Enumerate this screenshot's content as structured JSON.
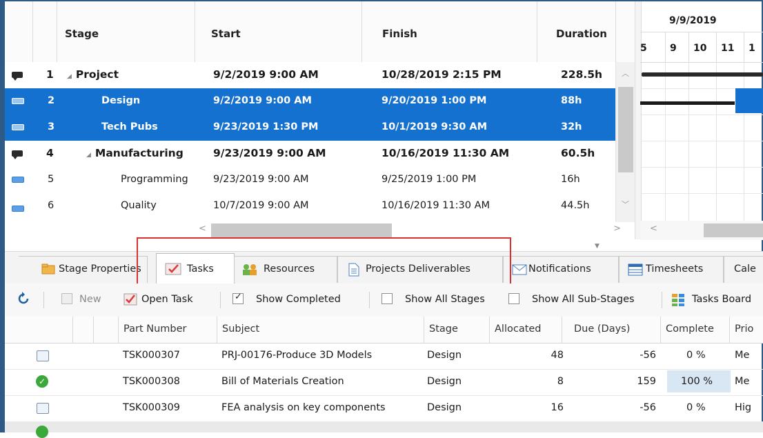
{
  "top_grid": {
    "headers": {
      "stage": "Stage",
      "start": "Start",
      "finish": "Finish",
      "duration": "Duration"
    },
    "rows": [
      {
        "num": "1",
        "stage": "Project",
        "start": "9/2/2019 9:00 AM",
        "finish": "10/28/2019 2:15 PM",
        "duration": "228.5h"
      },
      {
        "num": "2",
        "stage": "Design",
        "start": "9/2/2019 9:00 AM",
        "finish": "9/20/2019 1:00 PM",
        "duration": "88h"
      },
      {
        "num": "3",
        "stage": "Tech Pubs",
        "start": "9/23/2019 1:30 PM",
        "finish": "10/1/2019 9:30 AM",
        "duration": "32h"
      },
      {
        "num": "4",
        "stage": "Manufacturing",
        "start": "9/23/2019 9:00 AM",
        "finish": "10/16/2019 11:30 AM",
        "duration": "60.5h"
      },
      {
        "num": "5",
        "stage": "Programming",
        "start": "9/23/2019 9:00 AM",
        "finish": "9/25/2019 1:00 PM",
        "duration": "16h"
      },
      {
        "num": "6",
        "stage": "Quality",
        "start": "10/7/2019 9:00 AM",
        "finish": "10/16/2019 11:30 AM",
        "duration": "44.5h"
      }
    ]
  },
  "gantt": {
    "date": "9/9/2019",
    "days": [
      "5",
      "9",
      "10",
      "11",
      "1"
    ]
  },
  "tabs": [
    {
      "label": "Stage Properties",
      "icon": "stage-properties-icon"
    },
    {
      "label": "Tasks",
      "icon": "tasks-icon"
    },
    {
      "label": "Resources",
      "icon": "resources-icon"
    },
    {
      "label": "Projects Deliverables",
      "icon": "document-icon"
    },
    {
      "label": "Notifications",
      "icon": "envelope-icon"
    },
    {
      "label": "Timesheets",
      "icon": "timesheet-icon"
    },
    {
      "label": "Cale",
      "icon": ""
    }
  ],
  "toolbar": {
    "new": "New",
    "open_task": "Open Task",
    "show_completed": "Show Completed",
    "show_all_stages": "Show All Stages",
    "show_all_sub_stages": "Show All Sub-Stages",
    "tasks_board": "Tasks Board"
  },
  "task_table": {
    "headers": {
      "part_number": "Part Number",
      "subject": "Subject",
      "stage": "Stage",
      "allocated": "Allocated",
      "due_days": "Due (Days)",
      "complete": "Complete",
      "priority": "Prio"
    },
    "rows": [
      {
        "part_number": "TSK000307",
        "subject": "PRJ-00176-Produce 3D Models",
        "stage": "Design",
        "allocated": "48",
        "due_days": "-56",
        "complete": "0 %",
        "priority": "Me",
        "done": false
      },
      {
        "part_number": "TSK000308",
        "subject": "Bill of Materials Creation",
        "stage": "Design",
        "allocated": "8",
        "due_days": "159",
        "complete": "100 %",
        "priority": "Me",
        "done": true
      },
      {
        "part_number": "TSK000309",
        "subject": "FEA analysis on key components",
        "stage": "Design",
        "allocated": "16",
        "due_days": "-56",
        "complete": "0 %",
        "priority": "Hig",
        "done": false
      }
    ]
  },
  "colors": {
    "selection": "#1471cf",
    "highlight_box": "#d93030",
    "frame": "#2e5b86"
  }
}
